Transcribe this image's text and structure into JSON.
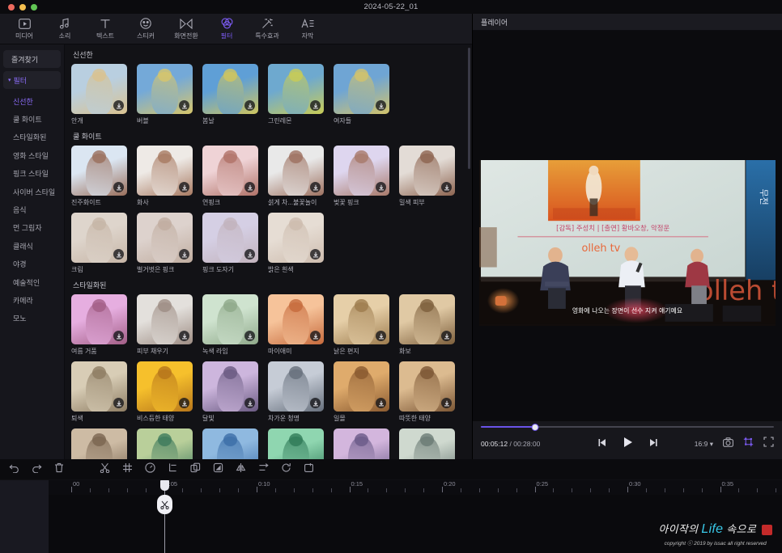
{
  "window": {
    "doc_title": "2024-05-22_01",
    "traffic_lights": [
      "close",
      "minimize",
      "maximize"
    ]
  },
  "toolbar": {
    "tabs": [
      {
        "label": "미디어",
        "icon": "media-icon",
        "active": false
      },
      {
        "label": "소리",
        "icon": "audio-icon",
        "active": false
      },
      {
        "label": "텍스트",
        "icon": "text-icon",
        "active": false
      },
      {
        "label": "스티커",
        "icon": "sticker-icon",
        "active": false
      },
      {
        "label": "화면전환",
        "icon": "transition-icon",
        "active": false
      },
      {
        "label": "필터",
        "icon": "filter-icon",
        "active": true
      },
      {
        "label": "특수효과",
        "icon": "effects-icon",
        "active": false
      },
      {
        "label": "자막",
        "icon": "caption-icon",
        "active": false
      }
    ],
    "accent_color": "#7d5cf5"
  },
  "categories": {
    "favorites_label": "즐겨찾기",
    "filter_group_label": "필터",
    "items": [
      {
        "label": "신선한",
        "selected": true
      },
      {
        "label": "쿨 화이트",
        "selected": false
      },
      {
        "label": "스타일화된",
        "selected": false
      },
      {
        "label": "영화 스타일",
        "selected": false
      },
      {
        "label": "핑크 스타일",
        "selected": false
      },
      {
        "label": "사이버 스타일",
        "selected": false
      },
      {
        "label": "음식",
        "selected": false
      },
      {
        "label": "먼 그림자",
        "selected": false
      },
      {
        "label": "클래식",
        "selected": false
      },
      {
        "label": "야경",
        "selected": false
      },
      {
        "label": "예술적인",
        "selected": false
      },
      {
        "label": "카메라",
        "selected": false
      },
      {
        "label": "모노",
        "selected": false
      }
    ]
  },
  "filter_sections": [
    {
      "title": "신선한",
      "rows": [
        [
          {
            "name": "안개",
            "c1": "#b9cfe0",
            "c2": "#d9c290",
            "downloadable": true
          },
          {
            "name": "버블",
            "c1": "#74a9d8",
            "c2": "#d8c66a",
            "downloadable": true
          },
          {
            "name": "봄날",
            "c1": "#5f9fd6",
            "c2": "#cfc55e",
            "downloadable": true
          },
          {
            "name": "그린레몬",
            "c1": "#6ea9cf",
            "c2": "#c9cc55",
            "downloadable": true
          },
          {
            "name": "여자들",
            "c1": "#6fa5d4",
            "c2": "#d3c36a",
            "downloadable": true
          }
        ]
      ]
    },
    {
      "title": "쿨 화이트",
      "rows": [
        [
          {
            "name": "진주화이트",
            "c1": "#dbe6f2",
            "c2": "#9a6f5c",
            "downloadable": true
          },
          {
            "name": "화사",
            "c1": "#eeeae6",
            "c2": "#a87a62",
            "downloadable": true
          },
          {
            "name": "연핑크",
            "c1": "#efd3d6",
            "c2": "#b07268",
            "downloadable": true
          },
          {
            "name": "섥게 차...불꽃놀이",
            "c1": "#e9e9e9",
            "c2": "#9d7160",
            "downloadable": true
          },
          {
            "name": "벚꽃 핑크",
            "c1": "#ded6ef",
            "c2": "#a8796a",
            "downloadable": true
          },
          {
            "name": "밀색 피부",
            "c1": "#e3dcd6",
            "c2": "#8d6450",
            "downloadable": true
          }
        ],
        [
          {
            "name": "크림",
            "c1": "#ded5cc",
            "c2": "#c6b5a6",
            "downloadable": true
          },
          {
            "name": "벌거벗은 핑크",
            "c1": "#ddd2cd",
            "c2": "#c0ada0",
            "downloadable": true
          },
          {
            "name": "핑크 도자기",
            "c1": "#d5cfe4",
            "c2": "#c2b3bd",
            "downloadable": true
          },
          {
            "name": "밝은 흰색",
            "c1": "#e6ddd4",
            "c2": "#cdbcae",
            "downloadable": true
          }
        ]
      ]
    },
    {
      "title": "스타일화된",
      "rows": [
        [
          {
            "name": "여름 거품",
            "c1": "#e6aee0",
            "c2": "#a25e86",
            "downloadable": true
          },
          {
            "name": "피부 채우기",
            "c1": "#e3e0dc",
            "c2": "#9e8d84",
            "downloadable": true
          },
          {
            "name": "녹색 라임",
            "c1": "#cfe3cf",
            "c2": "#8fa98a",
            "downloadable": true
          },
          {
            "name": "마이애미",
            "c1": "#f6c39a",
            "c2": "#c66a3c",
            "downloadable": true
          },
          {
            "name": "낡은 편지",
            "c1": "#e6cfa8",
            "c2": "#9d7c4e",
            "downloadable": true
          },
          {
            "name": "화보",
            "c1": "#e0c9a4",
            "c2": "#7d5f3c",
            "downloadable": true
          }
        ],
        [
          {
            "name": "퇴색",
            "c1": "#d8cdb6",
            "c2": "#8e7d63",
            "downloadable": true
          },
          {
            "name": "비스듬한 태양",
            "c1": "#f6c02c",
            "c2": "#b7761b",
            "downloadable": true
          },
          {
            "name": "달빛",
            "c1": "#cdb6dd",
            "c2": "#6a5a82",
            "downloadable": true
          },
          {
            "name": "차가운 청명",
            "c1": "#c6ccd6",
            "c2": "#666f7c",
            "downloadable": true
          },
          {
            "name": "일몰",
            "c1": "#dfab6c",
            "c2": "#8a5a30",
            "downloadable": true
          },
          {
            "name": "따뜻한 태양",
            "c1": "#dcbb90",
            "c2": "#7c5634",
            "downloadable": true
          }
        ],
        [
          {
            "name": "",
            "c1": "#cdbba4",
            "c2": "#7a6550",
            "downloadable": false
          },
          {
            "name": "",
            "c1": "#b9cf9a",
            "c2": "#3f7a5c",
            "downloadable": false
          },
          {
            "name": "",
            "c1": "#8fb9e0",
            "c2": "#3c6ea8",
            "downloadable": false
          },
          {
            "name": "",
            "c1": "#8fd6b0",
            "c2": "#2f7a58",
            "downloadable": false
          },
          {
            "name": "",
            "c1": "#d3b6dd",
            "c2": "#6a5a88",
            "downloadable": false
          },
          {
            "name": "",
            "c1": "#cfd9cf",
            "c2": "#6a7a74",
            "downloadable": false
          }
        ]
      ]
    }
  ],
  "player": {
    "panel_label": "플레이어",
    "current_time": "00:05:12",
    "total_time": "00:28:00",
    "time_separator": "/",
    "progress_percent": 18.5,
    "aspect_ratio": "16:9",
    "controls": [
      {
        "name": "prev-frame-button",
        "icon": "step-backward-icon"
      },
      {
        "name": "play-button",
        "icon": "play-icon"
      },
      {
        "name": "next-frame-button",
        "icon": "step-forward-icon"
      }
    ],
    "right_controls": [
      {
        "name": "snapshot-button",
        "icon": "camera-icon",
        "active": false
      },
      {
        "name": "crop-frame-button",
        "icon": "crop-frame-icon",
        "active": true
      },
      {
        "name": "fullscreen-button",
        "icon": "fullscreen-icon",
        "active": false
      }
    ],
    "video_overlay": {
      "subtitle": "영화에 나오는 장면이 선수 지켜 얘기예요",
      "poster_caption": "[감독] 주성치  |  [출연] 황바오창, 악정운",
      "brand": "olleh tv"
    }
  },
  "timeline": {
    "tools": [
      {
        "name": "undo-button",
        "icon": "undo-icon"
      },
      {
        "name": "redo-button",
        "icon": "redo-icon"
      },
      {
        "name": "delete-button",
        "icon": "trash-icon"
      },
      {
        "name": "split-button",
        "icon": "scissors-icon"
      },
      {
        "name": "keyframe-button",
        "icon": "keyframe-icon"
      },
      {
        "name": "speed-button",
        "icon": "speed-icon"
      },
      {
        "name": "crop-button",
        "icon": "crop-icon"
      },
      {
        "name": "duplicate-button",
        "icon": "duplicate-icon"
      },
      {
        "name": "mask-button",
        "icon": "mask-icon"
      },
      {
        "name": "mirror-button",
        "icon": "mirror-icon"
      },
      {
        "name": "flip-button",
        "icon": "flip-icon"
      },
      {
        "name": "rotate-button",
        "icon": "rotate-icon"
      },
      {
        "name": "freeze-button",
        "icon": "freeze-icon"
      }
    ],
    "ruler_labels": [
      "00",
      "0:05",
      "0:10",
      "0:15",
      "0:20",
      "0:25",
      "0:30",
      "0:35"
    ],
    "playhead_position_label": "0:05",
    "cut_tool_icon": "scissors-icon"
  },
  "watermark": {
    "line1_pre": "아이작의",
    "line1_life": "Life",
    "line1_post": "속으로",
    "line2": "copyright ⓒ 2019 by issac all right reserved"
  }
}
